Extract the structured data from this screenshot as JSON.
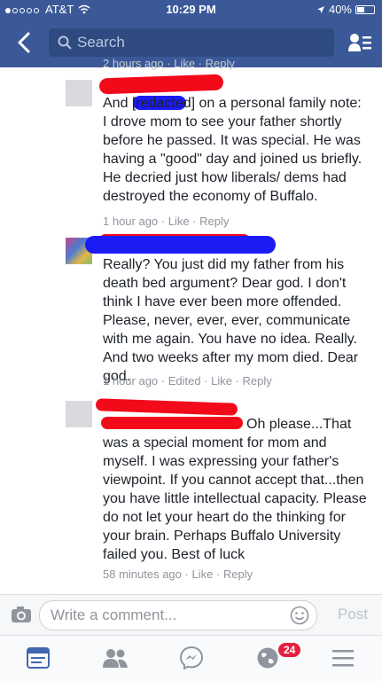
{
  "status": {
    "carrier": "AT&T",
    "time": "10:29 PM",
    "battery": "40%"
  },
  "nav": {
    "search_placeholder": "Search"
  },
  "top_partial": {
    "meta": "2 hours ago · Like · Reply"
  },
  "comments": [
    {
      "text": "And [redacted] on a personal family note: I drove mom to see your father shortly before he passed. It was special. He was having a \"good\" day and joined us briefly. He decried just how liberals/ dems had destroyed the economy of Buffalo.",
      "meta": "1 hour ago · Like · Reply"
    },
    {
      "text": "Really? You just did my father from his death bed argument? Dear god. I don't think I have ever been more offended. Please, never, ever, ever, communicate with me again. You have no idea. Really. And two weeks after my mom died. Dear god.",
      "meta": "1 hour ago · Edited · Like · Reply"
    },
    {
      "text": "Oh please...That was a special moment for mom and myself. I was expressing your father's viewpoint. If you cannot accept that...then you have little intellectual capacity. Please do not let your heart do the thinking for your brain. Perhaps Buffalo University failed you. Best of luck",
      "meta": "58 minutes ago · Like · Reply"
    }
  ],
  "composer": {
    "placeholder": "Write a comment...",
    "post_label": "Post"
  },
  "tabbar": {
    "notifications_badge": "24"
  },
  "colors": {
    "brand": "#3b5998",
    "meta": "#90949c",
    "badge": "#e41e3f"
  }
}
